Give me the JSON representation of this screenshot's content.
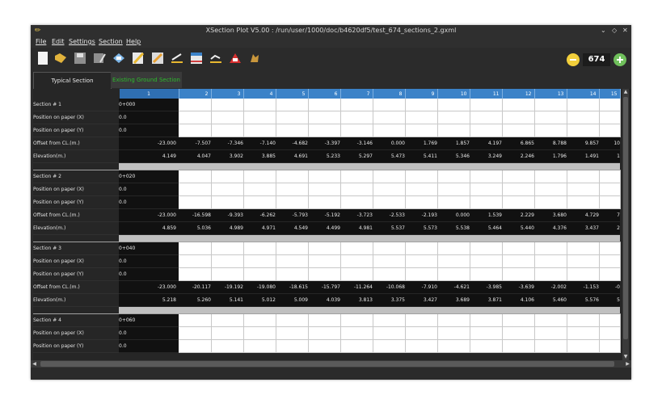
{
  "window": {
    "title": "XSection Plot V5.00 : /run/user/1000/doc/b4620df5/test_674_sections_2.gxml"
  },
  "menu": [
    "File",
    "Edit",
    "Settings",
    "Section",
    "Help"
  ],
  "toolbar": {
    "icons": [
      "new-file-icon",
      "open-folder-icon",
      "save-icon",
      "save-as-icon",
      "print-icon",
      "edit-pencil-icon",
      "tools-icon",
      "plot-section-icon",
      "table-icon",
      "plot-ground-icon",
      "pdf-icon",
      "animal-icon"
    ],
    "counter_value": "674"
  },
  "tabs": [
    {
      "label": "Typical Section",
      "active": true
    },
    {
      "label": "Existing Ground Section",
      "active": false,
      "color": "#2dbb2d"
    }
  ],
  "columns": [
    "1",
    "2",
    "3",
    "4",
    "5",
    "6",
    "7",
    "8",
    "9",
    "10",
    "11",
    "12",
    "13",
    "14",
    "15"
  ],
  "row_labels": {
    "position_x": "Position on paper (X)",
    "position_y": "Position on paper (Y)",
    "offset": "Offset from CL.(m.)",
    "elevation": "Elevation(m.)"
  },
  "sections": [
    {
      "name": "Section # 1",
      "chainage": "0+000",
      "pos_x": "0.0",
      "pos_y": "0.0",
      "offsets": [
        "-23.000",
        "-7.507",
        "-7.346",
        "-7.140",
        "-4.682",
        "-3.397",
        "-3.146",
        "0.000",
        "1.769",
        "1.857",
        "4.197",
        "6.865",
        "8.788",
        "9.857",
        "10"
      ],
      "elevations": [
        "4.149",
        "4.047",
        "3.902",
        "3.885",
        "4.691",
        "5.233",
        "5.297",
        "5.473",
        "5.411",
        "5.346",
        "3.249",
        "2.246",
        "1.796",
        "1.491",
        "1"
      ]
    },
    {
      "name": "Section # 2",
      "chainage": "0+020",
      "pos_x": "0.0",
      "pos_y": "0.0",
      "offsets": [
        "-23.000",
        "-16.598",
        "-9.393",
        "-6.262",
        "-5.793",
        "-5.192",
        "-3.723",
        "-2.533",
        "-2.193",
        "0.000",
        "1.539",
        "2.229",
        "3.680",
        "4.729",
        "7"
      ],
      "elevations": [
        "4.859",
        "5.036",
        "4.989",
        "4.971",
        "4.549",
        "4.499",
        "4.981",
        "5.537",
        "5.573",
        "5.538",
        "5.464",
        "5.440",
        "4.376",
        "3.437",
        "2"
      ]
    },
    {
      "name": "Section # 3",
      "chainage": "0+040",
      "pos_x": "0.0",
      "pos_y": "0.0",
      "offsets": [
        "-23.000",
        "-20.117",
        "-19.192",
        "-19.080",
        "-18.615",
        "-15.797",
        "-11.264",
        "-10.068",
        "-7.910",
        "-4.621",
        "-3.985",
        "-3.639",
        "-2.002",
        "-1.153",
        "-0"
      ],
      "elevations": [
        "5.218",
        "5.260",
        "5.141",
        "5.012",
        "5.009",
        "4.039",
        "3.813",
        "3.375",
        "3.427",
        "3.689",
        "3.871",
        "4.106",
        "5.460",
        "5.576",
        "5"
      ]
    },
    {
      "name": "Section # 4",
      "chainage": "0+060",
      "pos_x": "0.0",
      "pos_y": "0.0",
      "offsets": [],
      "elevations": []
    }
  ]
}
